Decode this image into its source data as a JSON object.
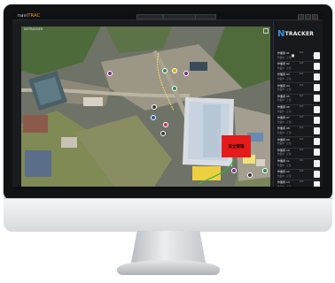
{
  "app": {
    "title": "NVTRACKER",
    "logo_prefix": "navi",
    "logo_accent": "TRAC",
    "topbar_items": [
      "",
      "",
      ""
    ]
  },
  "map": {
    "label": "NVTRACKER",
    "marker_label": "安全管理"
  },
  "panel": {
    "brand_mark": "N",
    "brand_text": "TRACKER",
    "workers": [
      {
        "name": "作業者 01",
        "sub": "作業中 · 正常",
        "dist": "0.0"
      },
      {
        "name": "作業者 02",
        "sub": "作業中 · 正常",
        "dist": "0.0"
      },
      {
        "name": "作業者 03",
        "sub": "作業中 · 正常",
        "dist": "0.0"
      },
      {
        "name": "作業者 04",
        "sub": "作業中 · 正常",
        "dist": "0.0"
      },
      {
        "name": "作業者 05",
        "sub": "作業中 · 正常",
        "dist": "0.0"
      },
      {
        "name": "作業者 06",
        "sub": "作業中 · 正常",
        "dist": "0.0"
      },
      {
        "name": "作業者 07",
        "sub": "作業中 · 正常",
        "dist": "0.0"
      },
      {
        "name": "作業者 08",
        "sub": "作業中 · 正常",
        "dist": "0.0"
      },
      {
        "name": "作業者 09",
        "sub": "作業中 · 正常",
        "dist": "0.0"
      },
      {
        "name": "作業者 10",
        "sub": "作業中 · 正常",
        "dist": "0.0"
      },
      {
        "name": "作業者 11",
        "sub": "作業中 · 正常",
        "dist": "0.0"
      },
      {
        "name": "作業者 12",
        "sub": "作業中 · 正常",
        "dist": "0.0"
      },
      {
        "name": "作業者 13",
        "sub": "作業中 · 正常",
        "dist": "0.0"
      }
    ]
  },
  "colors": {
    "accent": "#3d8fe0",
    "alert": "#e51a1a",
    "logo_accent": "#f0a020",
    "marker_colors": [
      "#7a2a8a",
      "#2e8b57",
      "#d4b000",
      "#3a3a3a",
      "#c03060",
      "#1e5aa8"
    ]
  }
}
